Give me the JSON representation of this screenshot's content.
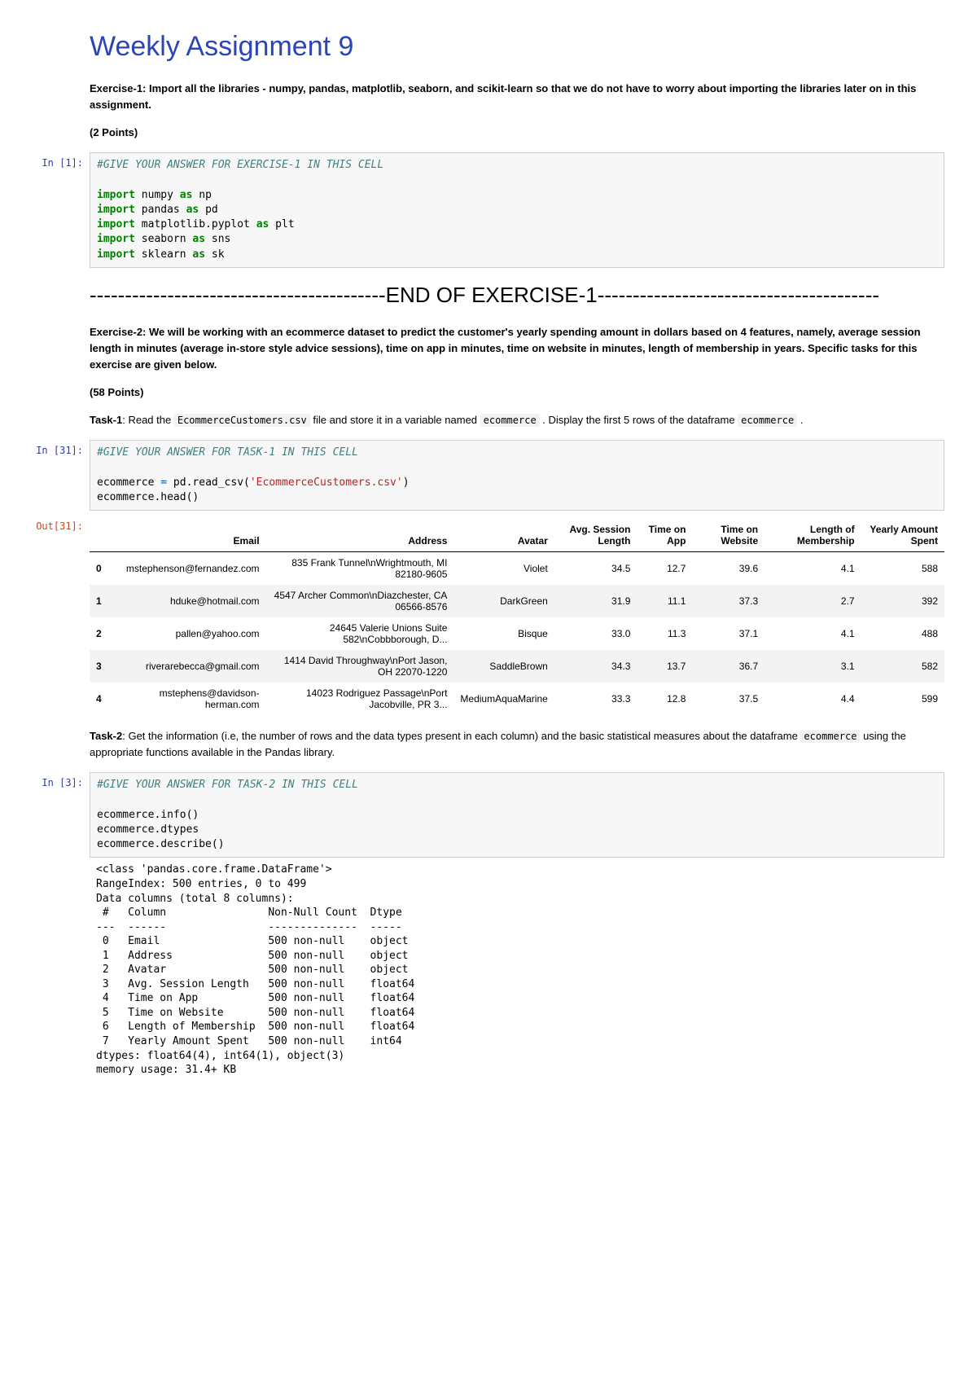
{
  "title": "Weekly Assignment 9",
  "ex1_paragraph": "Exercise-1: Import all the libraries - numpy, pandas, matplotlib, seaborn, and scikit-learn so that we do not have to worry about importing the libraries later on in this assignment.",
  "ex1_points": "(2 Points)",
  "prompt_in1": "In [1]:",
  "code1_comment": "#GIVE YOUR ANSWER FOR EXERCISE-1 IN THIS CELL",
  "code1_l1a": "import",
  "code1_l1b": " numpy ",
  "code1_l1c": "as",
  "code1_l1d": " np",
  "code1_l2a": "import",
  "code1_l2b": " pandas ",
  "code1_l2c": "as",
  "code1_l2d": " pd",
  "code1_l3a": "import",
  "code1_l3b": " matplotlib.pyplot ",
  "code1_l3c": "as",
  "code1_l3d": " plt",
  "code1_l4a": "import",
  "code1_l4b": " seaborn ",
  "code1_l4c": "as",
  "code1_l4d": " sns",
  "code1_l5a": "import",
  "code1_l5b": " sklearn ",
  "code1_l5c": "as",
  "code1_l5d": " sk",
  "end_exercise_1": "------------------------------------------END OF EXERCISE-1----------------------------------------",
  "ex2_paragraph": "Exercise-2: We will be working with an ecommerce dataset to predict the customer's yearly spending amount in dollars based on 4 features, namely, average session length in minutes (average in-store style advice sessions), time on app in minutes, time on website in minutes, length of membership in years. Specific tasks for this exercise are given below.",
  "ex2_points": "(58 Points)",
  "task1_prefix": "Task-1",
  "task1_text1": ": Read the ",
  "task1_code1": "EcommerceCustomers.csv",
  "task1_text2": " file and store it in a variable named ",
  "task1_code2": "ecommerce",
  "task1_text3": " . Display the first 5 rows of the dataframe ",
  "task1_code3": "ecommerce",
  "task1_text4": " .",
  "prompt_in31": "In [31]:",
  "code2_comment": "#GIVE YOUR ANSWER FOR TASK-1 IN THIS CELL",
  "code2_l1a": "ecommerce ",
  "code2_l1b": "=",
  "code2_l1c": " pd.read_csv(",
  "code2_l1d": "'EcommerceCustomers.csv'",
  "code2_l1e": ")",
  "code2_l2": "ecommerce.head()",
  "prompt_out31": "Out[31]:",
  "table": {
    "headers": [
      "",
      "Email",
      "Address",
      "Avatar",
      "Avg. Session Length",
      "Time on App",
      "Time on Website",
      "Length of Membership",
      "Yearly Amount Spent"
    ],
    "rows": [
      [
        "0",
        "mstephenson@fernandez.com",
        "835 Frank Tunnel\\nWrightmouth, MI 82180-9605",
        "Violet",
        "34.5",
        "12.7",
        "39.6",
        "4.1",
        "588"
      ],
      [
        "1",
        "hduke@hotmail.com",
        "4547 Archer Common\\nDiazchester, CA 06566-8576",
        "DarkGreen",
        "31.9",
        "11.1",
        "37.3",
        "2.7",
        "392"
      ],
      [
        "2",
        "pallen@yahoo.com",
        "24645 Valerie Unions Suite 582\\nCobbborough, D...",
        "Bisque",
        "33.0",
        "11.3",
        "37.1",
        "4.1",
        "488"
      ],
      [
        "3",
        "riverarebecca@gmail.com",
        "1414 David Throughway\\nPort Jason, OH 22070-1220",
        "SaddleBrown",
        "34.3",
        "13.7",
        "36.7",
        "3.1",
        "582"
      ],
      [
        "4",
        "mstephens@davidson-herman.com",
        "14023 Rodriguez Passage\\nPort Jacobville, PR 3...",
        "MediumAquaMarine",
        "33.3",
        "12.8",
        "37.5",
        "4.4",
        "599"
      ]
    ]
  },
  "task2_prefix": "Task-2",
  "task2_text1": ": Get the information (i.e, the number of rows and the data types present in each column) and the basic statistical measures about the dataframe ",
  "task2_code1": "ecommerce",
  "task2_text2": " using the appropriate functions available in the Pandas library.",
  "prompt_in3": "In [3]:",
  "code3_comment": "#GIVE YOUR ANSWER FOR TASK-2 IN THIS CELL",
  "code3_l1": "ecommerce.info()",
  "code3_l2": "ecommerce.dtypes",
  "code3_l3": "ecommerce.describe()",
  "info_output": "<class 'pandas.core.frame.DataFrame'>\nRangeIndex: 500 entries, 0 to 499\nData columns (total 8 columns):\n #   Column                Non-Null Count  Dtype  \n---  ------                --------------  -----  \n 0   Email                 500 non-null    object \n 1   Address               500 non-null    object \n 2   Avatar                500 non-null    object \n 3   Avg. Session Length   500 non-null    float64\n 4   Time on App           500 non-null    float64\n 5   Time on Website       500 non-null    float64\n 6   Length of Membership  500 non-null    float64\n 7   Yearly Amount Spent   500 non-null    int64  \ndtypes: float64(4), int64(1), object(3)\nmemory usage: 31.4+ KB"
}
